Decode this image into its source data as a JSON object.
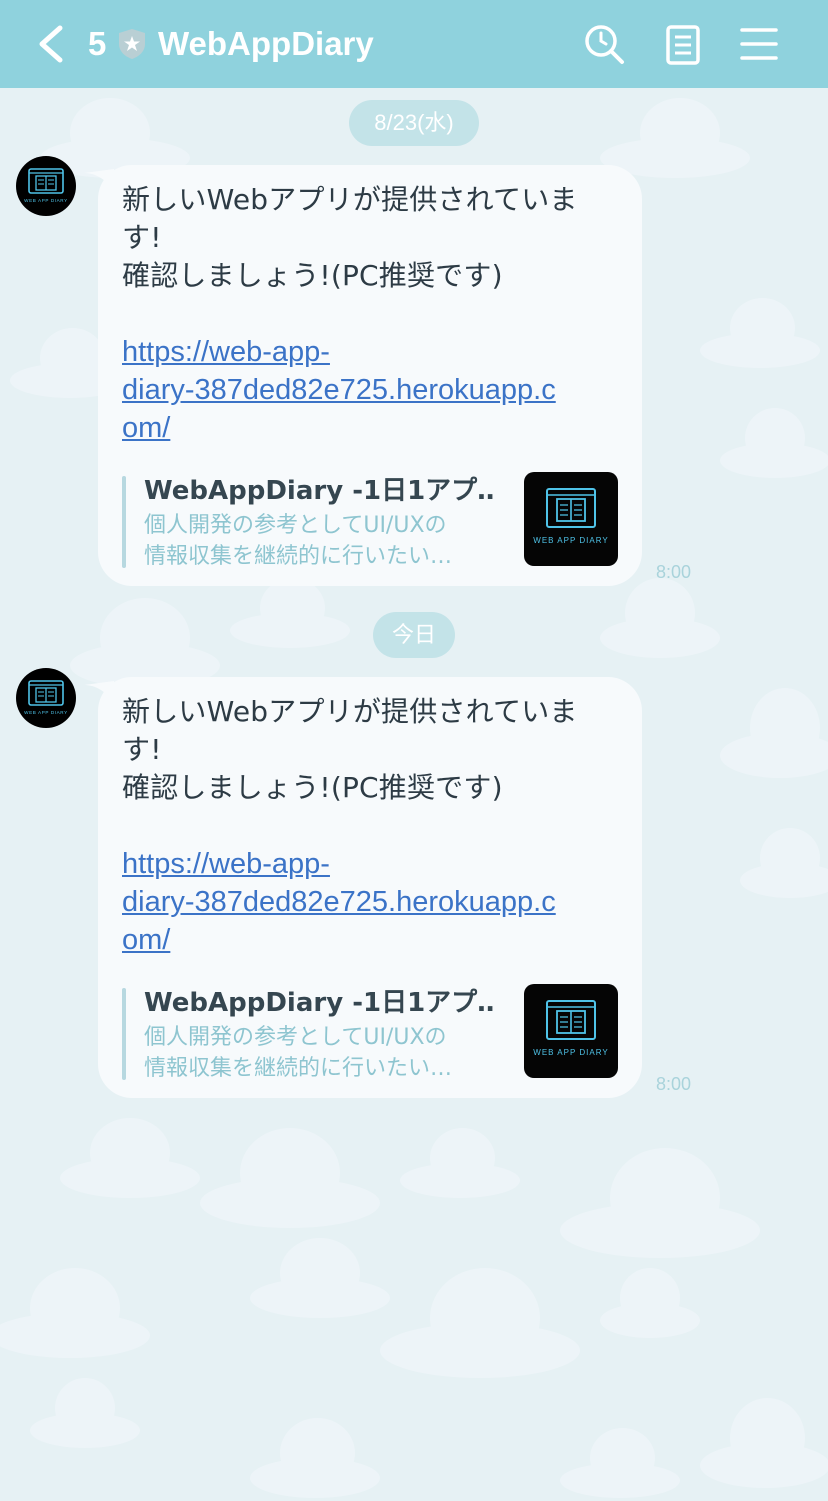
{
  "header": {
    "back_icon": "chevron-left-icon",
    "unread_count": "5",
    "badge_icon": "official-shield-star-icon",
    "title": "WebAppDiary",
    "search_icon": "search-icon",
    "notes_icon": "notes-icon",
    "menu_icon": "hamburger-menu-icon",
    "color": "#8fd2dd"
  },
  "date_separators": [
    "8/23(水)",
    "今日"
  ],
  "messages": [
    {
      "lines": [
        "新しいWebアプリが提供されていま",
        "す!",
        "確認しましょう!(PC推奨です)"
      ],
      "link_lines": [
        "https://web-app-",
        "diary-387ded82e725.herokuapp.c",
        "om/"
      ],
      "preview": {
        "title": "WebAppDiary -1日1アプ…",
        "desc_lines": [
          "個人開発の参考としてUI/UXの",
          "情報収集を継続的に行いたい…"
        ],
        "thumb_caption": "WEB APP DIARY"
      },
      "avatar_caption": "WEB APP DIARY",
      "time": "8:00"
    },
    {
      "lines": [
        "新しいWebアプリが提供されていま",
        "す!",
        "確認しましょう!(PC推奨です)"
      ],
      "link_lines": [
        "https://web-app-",
        "diary-387ded82e725.herokuapp.c",
        "om/"
      ],
      "preview": {
        "title": "WebAppDiary -1日1アプ…",
        "desc_lines": [
          "個人開発の参考としてUI/UXの",
          "情報収集を継続的に行いたい…"
        ],
        "thumb_caption": "WEB APP DIARY"
      },
      "avatar_caption": "WEB APP DIARY",
      "time": "8:00"
    }
  ],
  "colors": {
    "background": "#e6f1f4",
    "bubble": "#f7fafc",
    "link": "#3b73c7",
    "time": "#a9d3db",
    "date_pill": "#c3e3e8"
  }
}
